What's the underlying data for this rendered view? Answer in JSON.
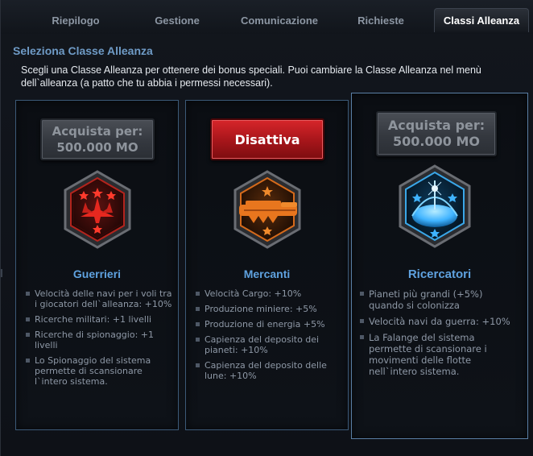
{
  "tabs": [
    {
      "label": "Riepilogo",
      "active": false
    },
    {
      "label": "Gestione",
      "active": false
    },
    {
      "label": "Comunicazione",
      "active": false
    },
    {
      "label": "Richieste",
      "active": false
    },
    {
      "label": "Classi Alleanza",
      "active": true
    }
  ],
  "section_title": "Seleziona Classe Alleanza",
  "intro": "Scegli una Classe Alleanza per ottenere dei bonus speciali. Puoi cambiare la Classe Alleanza nel menù dell`alleanza (a patto che tu abbia i permessi necessari).",
  "classes": [
    {
      "name": "Guerrieri",
      "button": {
        "line1": "Acquista per:",
        "line2": "500.000 MO"
      },
      "emblem": "warrior-emblem-icon",
      "bonuses": [
        "Velocità delle navi per i voli tra i giocatori dell`alleanza: +10%",
        "Ricerche militari: +1 livelli",
        "Ricerche di spionaggio: +1 livelli",
        "Lo Spionaggio del sistema permette di scansionare l`intero sistema."
      ]
    },
    {
      "name": "Mercanti",
      "button": {
        "label": "Disattiva"
      },
      "emblem": "trader-emblem-icon",
      "bonuses": [
        "Velocità Cargo: +10%",
        "Produzione miniere: +5%",
        "Produzione di energia +5%",
        "Capienza del deposito dei pianeti: +10%",
        "Capienza del deposito delle lune: +10%"
      ]
    },
    {
      "name": "Ricercatori",
      "button": {
        "line1": "Acquista per:",
        "line2": "500.000 MO"
      },
      "emblem": "researcher-emblem-icon",
      "bonuses": [
        "Pianeti più grandi (+5%) quando si colonizza",
        "Velocità navi da guerra: +10%",
        "La Falange del sistema permette di scansionare i movimenti delle flotte nell`intero sistema."
      ]
    }
  ],
  "colors": {
    "accent_blue": "#5fa2e0",
    "title_blue": "#6f9bc6",
    "deactivate_red": "#c41c21",
    "warrior_red": "#d8261f",
    "trader_orange": "#e8761e",
    "researcher_blue": "#3fb3ff"
  }
}
